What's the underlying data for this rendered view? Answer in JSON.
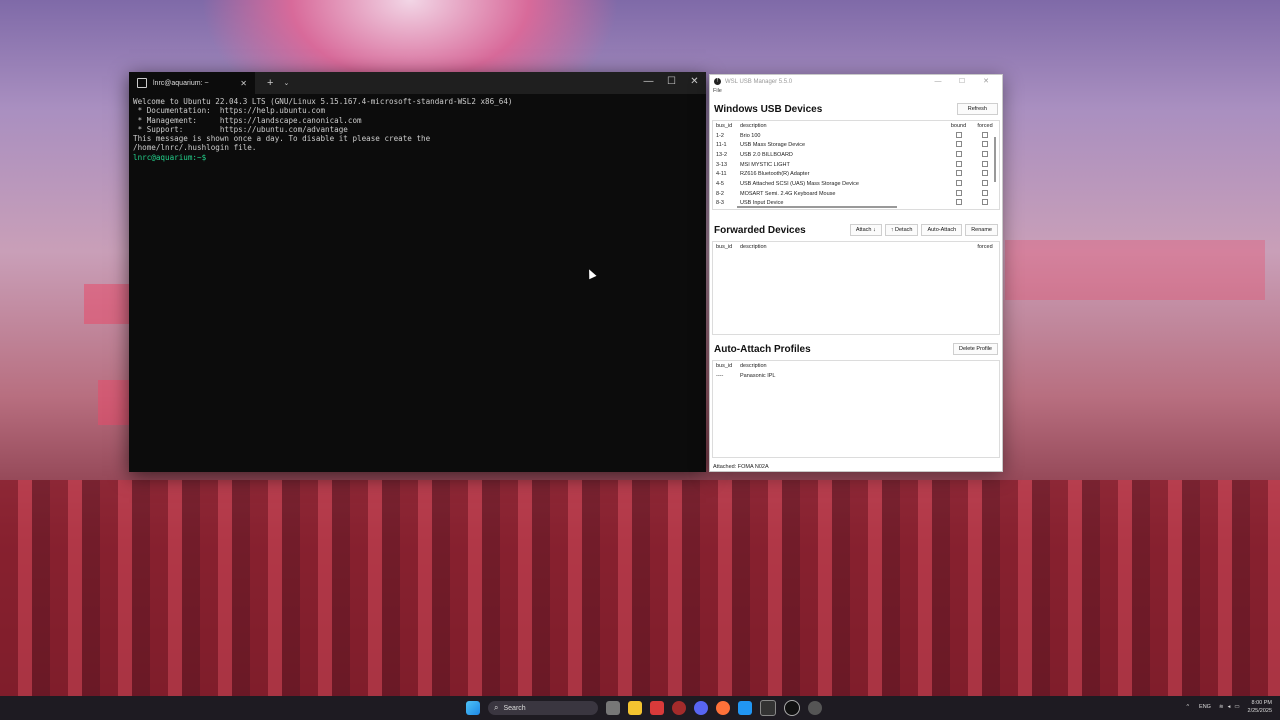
{
  "terminal": {
    "tab_title": "lnrc@aquarium: ~",
    "tab_close": "✕",
    "new_tab": "+",
    "dropdown": "⌄",
    "controls": [
      "—",
      "☐",
      "✕"
    ],
    "lines": [
      "Welcome to Ubuntu 22.04.3 LTS (GNU/Linux 5.15.167.4-microsoft-standard-WSL2 x86_64)",
      "",
      " * Documentation:  https://help.ubuntu.com",
      " * Management:     https://landscape.canonical.com",
      " * Support:        https://ubuntu.com/advantage",
      "",
      "",
      "This message is shown once a day. To disable it please create the",
      "/home/lnrc/.hushlogin file."
    ],
    "prompt": "lnrc@aquarium:~$"
  },
  "usb_manager": {
    "title": "WSL USB Manager 5.5.0",
    "menu": "File",
    "controls": [
      "—",
      "☐",
      "✕"
    ],
    "windows_devices": {
      "heading": "Windows USB Devices",
      "refresh": "Refresh",
      "headers": {
        "bus": "bus_id",
        "desc": "description",
        "bound": "bound",
        "forced": "forced"
      },
      "rows": [
        {
          "bus": "1-2",
          "desc": "Brio 100"
        },
        {
          "bus": "11-1",
          "desc": "USB Mass Storage Device"
        },
        {
          "bus": "13-2",
          "desc": "USB 2.0 BILLBOARD"
        },
        {
          "bus": "3-13",
          "desc": "MSI MYSTIC LIGHT"
        },
        {
          "bus": "4-11",
          "desc": "RZ616 Bluetooth(R) Adapter"
        },
        {
          "bus": "4-5",
          "desc": "USB Attached SCSI (UAS) Mass Storage Device"
        },
        {
          "bus": "8-2",
          "desc": "MOSART Semi. 2.4G Keyboard Mouse"
        },
        {
          "bus": "8-3",
          "desc": "USB Input Device"
        }
      ]
    },
    "forwarded": {
      "heading": "Forwarded Devices",
      "attach": "Attach ↓",
      "detach": "↑ Detach",
      "auto_attach": "Auto-Attach",
      "rename": "Rename",
      "headers": {
        "bus": "bus_id",
        "desc": "description",
        "forced": "forced"
      }
    },
    "profiles": {
      "heading": "Auto-Attach Profiles",
      "delete": "Delete Profile",
      "headers": {
        "bus": "bus_id",
        "desc": "description"
      },
      "rows": [
        {
          "bus": "----",
          "desc": "Panasonic IPL"
        }
      ]
    },
    "status": "Attached: FOMA N02A"
  },
  "taskbar": {
    "search": "Search",
    "lang": "ENG",
    "time": "8:00 PM",
    "date": "2/25/2025",
    "icons": [
      "windows-icon",
      "task-view-icon",
      "file-explorer-icon",
      "app-red-icon",
      "app-bug-icon",
      "discord-icon",
      "firefox-icon",
      "app-blue-icon",
      "terminal-icon",
      "usb-manager-icon",
      "app-settings-icon"
    ]
  }
}
